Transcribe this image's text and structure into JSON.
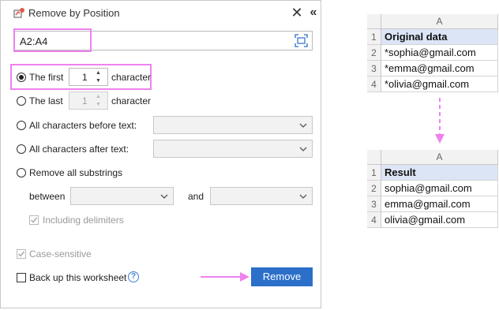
{
  "dialog": {
    "title": "Remove by Position",
    "range_value": "A2:A4",
    "options": {
      "first": {
        "label": "The first",
        "count": "1",
        "suffix": "character",
        "selected": true
      },
      "last": {
        "label": "The last",
        "count": "1",
        "suffix": "character",
        "selected": false
      },
      "before_text": {
        "label": "All characters before text:",
        "selected": false
      },
      "after_text": {
        "label": "All characters after text:",
        "selected": false
      },
      "substrings": {
        "label": "Remove all substrings",
        "selected": false,
        "between_label": "between",
        "and_label": "and",
        "delimiters_label": "Including delimiters",
        "delimiters_checked": true
      }
    },
    "case_sensitive_label": "Case-sensitive",
    "case_sensitive_checked": true,
    "backup_label": "Back up this worksheet",
    "backup_checked": false,
    "help_symbol": "?",
    "remove_label": "Remove",
    "close_symbol": "✕",
    "collapse_symbol": "«",
    "accent_color": "#2b6fc9",
    "highlight_color": "#ee82ee"
  },
  "before_sheet": {
    "column_header": "A",
    "rows": [
      {
        "num": "1",
        "value": "Original data"
      },
      {
        "num": "2",
        "value": "*sophia@gmail.com"
      },
      {
        "num": "3",
        "value": "*emma@gmail.com"
      },
      {
        "num": "4",
        "value": "*olivia@gmail.com"
      }
    ]
  },
  "after_sheet": {
    "column_header": "A",
    "rows": [
      {
        "num": "1",
        "value": "Result"
      },
      {
        "num": "2",
        "value": "sophia@gmail.com"
      },
      {
        "num": "3",
        "value": "emma@gmail.com"
      },
      {
        "num": "4",
        "value": "olivia@gmail.com"
      }
    ]
  }
}
